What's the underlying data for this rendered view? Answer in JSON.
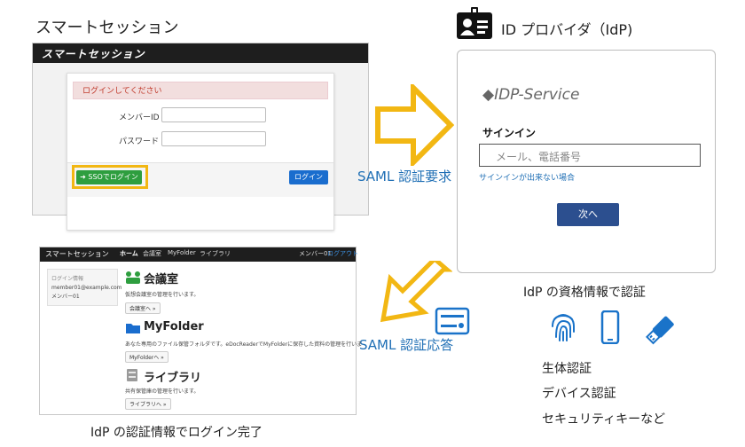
{
  "smart_session": {
    "heading": "スマートセッション",
    "window_title": "スマートセッション",
    "alert": "ログインしてください",
    "member_id_label": "メンバーID",
    "password_label": "パスワード",
    "sso_button": "➜ SSOでログイン",
    "login_button": "ログイン"
  },
  "saml": {
    "request_label": "SAML 認証要求",
    "response_label": "SAML 認証応答"
  },
  "idp": {
    "heading": "ID プロバイダ（IdP)",
    "logo": "◆IDP-Service",
    "signin_title": "サインイン",
    "input_placeholder": "メール、電話番号",
    "help_link": "サインインが出来ない場合",
    "next_button": "次へ",
    "auth_caption": "IdP の資格情報で認証"
  },
  "auth_methods": [
    "生体認証",
    "デバイス認証",
    "セキュリティキーなど"
  ],
  "portal": {
    "nav_title": "スマートセッション",
    "nav_items": [
      "ホーム",
      "会議室",
      "MyFolder",
      "ライブラリ"
    ],
    "nav_user": "メンバー01",
    "nav_logout": "ログアウト",
    "side_label": "ログイン情報",
    "side_email": "member01@example.com",
    "side_name": "メンバー01",
    "sections": [
      {
        "title": "会議室",
        "desc": "仮想会議室の管理を行います。",
        "button": "会議室へ »"
      },
      {
        "title": "MyFolder",
        "desc": "あなた専用のファイル保管フォルダです。eDocReaderでMyFolderに保存した資料の管理を行いま",
        "button": "MyFolderへ »"
      },
      {
        "title": "ライブラリ",
        "desc": "共有保管庫の管理を行います。",
        "button": "ライブラリへ »"
      }
    ],
    "caption": "IdP の認証情報でログイン完了"
  },
  "colors": {
    "arrow_yellow": "#f2b713",
    "saml_blue": "#1f6fb5",
    "sso_green": "#2e9e3f",
    "login_blue": "#1a6dce",
    "idp_next": "#2c4f8f"
  }
}
